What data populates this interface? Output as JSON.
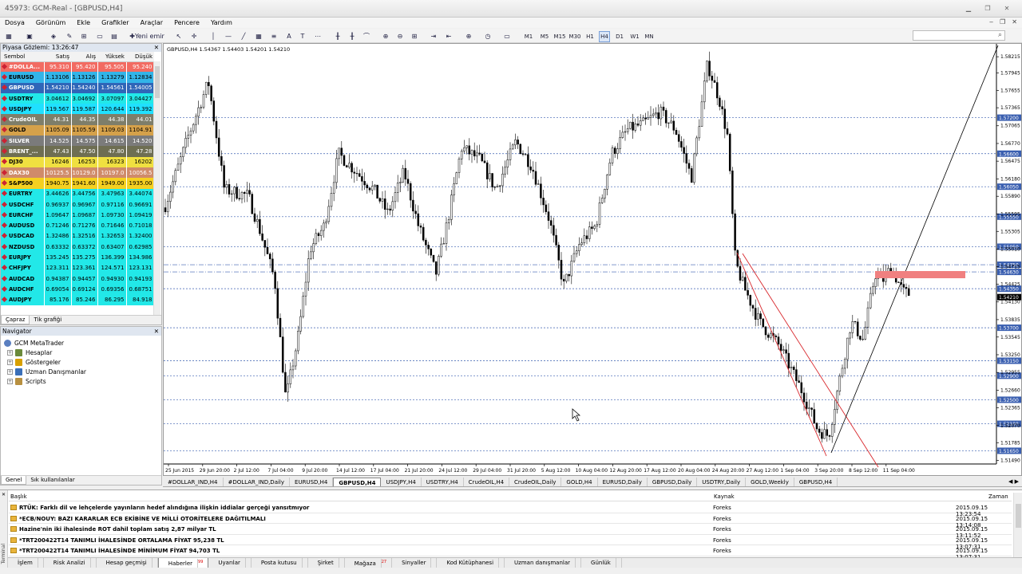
{
  "window": {
    "title": "45973: GCM-Real - [GBPUSD,H4]"
  },
  "menu": [
    "Dosya",
    "Görünüm",
    "Ekle",
    "Grafikler",
    "Araçlar",
    "Pencere",
    "Yardım"
  ],
  "toolbar": {
    "new_order": "Yeni emir",
    "timeframes": [
      "M1",
      "M5",
      "M15",
      "M30",
      "H1",
      "H4",
      "D1",
      "W1",
      "MN"
    ]
  },
  "market_watch": {
    "title": "Piyasa Gözlemi: 13:26:47",
    "columns": [
      "Sembol",
      "Satış",
      "Alış",
      "Yüksek",
      "Düşük"
    ],
    "rows": [
      {
        "sym": "#DOLLA...",
        "sell": "95.310",
        "buy": "95.420",
        "high": "95.505",
        "low": "95.240",
        "bg": "#f26b62",
        "fg": "#ffffff"
      },
      {
        "sym": "EURUSD",
        "sell": "1.13106",
        "buy": "1.13126",
        "high": "1.13279",
        "low": "1.12834",
        "bg": "#32b4e8",
        "fg": "#000000"
      },
      {
        "sym": "GBPUSD",
        "sell": "1.54210",
        "buy": "1.54240",
        "high": "1.54561",
        "low": "1.54005",
        "bg": "#2f66b8",
        "fg": "#ffffff"
      },
      {
        "sym": "USDTRY",
        "sell": "3.04612",
        "buy": "3.04692",
        "high": "3.07097",
        "low": "3.04427",
        "bg": "#22e8e8",
        "fg": "#000000"
      },
      {
        "sym": "USDJPY",
        "sell": "119.567",
        "buy": "119.587",
        "high": "120.644",
        "low": "119.392",
        "bg": "#20e0ff",
        "fg": "#000000"
      },
      {
        "sym": "CrudeOIL",
        "sell": "44.31",
        "buy": "44.35",
        "high": "44.38",
        "low": "44.01",
        "bg": "#7e7e6a",
        "fg": "#ffffff"
      },
      {
        "sym": "GOLD",
        "sell": "1105.09",
        "buy": "1105.59",
        "high": "1109.03",
        "low": "1104.91",
        "bg": "#d5a14a",
        "fg": "#000000"
      },
      {
        "sym": "SILVER",
        "sell": "14.525",
        "buy": "14.575",
        "high": "14.615",
        "low": "14.520",
        "bg": "#7b7b7b",
        "fg": "#ffffff"
      },
      {
        "sym": "BRENT_...",
        "sell": "47.43",
        "buy": "47.50",
        "high": "47.80",
        "low": "47.28",
        "bg": "#6e6e52",
        "fg": "#ffffff"
      },
      {
        "sym": "DJ30",
        "sell": "16246",
        "buy": "16253",
        "high": "16323",
        "low": "16202",
        "bg": "#f0e040",
        "fg": "#000000"
      },
      {
        "sym": "DAX30",
        "sell": "10125.5",
        "buy": "10129.0",
        "high": "10197.0",
        "low": "10056.5",
        "bg": "#d08b6a",
        "fg": "#ffffff"
      },
      {
        "sym": "S&P500",
        "sell": "1940.75",
        "buy": "1941.60",
        "high": "1949.00",
        "low": "1935.00",
        "bg": "#f5d020",
        "fg": "#000000"
      },
      {
        "sym": "EURTRY",
        "sell": "3.44626",
        "buy": "3.44756",
        "high": "3.47963",
        "low": "3.44074",
        "bg": "#22e8e8",
        "fg": "#000000"
      },
      {
        "sym": "USDCHF",
        "sell": "0.96937",
        "buy": "0.96967",
        "high": "0.97116",
        "low": "0.96691",
        "bg": "#22e8e8",
        "fg": "#000000"
      },
      {
        "sym": "EURCHF",
        "sell": "1.09647",
        "buy": "1.09687",
        "high": "1.09730",
        "low": "1.09419",
        "bg": "#22e8e8",
        "fg": "#000000"
      },
      {
        "sym": "AUDUSD",
        "sell": "0.71246",
        "buy": "0.71276",
        "high": "0.71646",
        "low": "0.71018",
        "bg": "#22e8e8",
        "fg": "#000000"
      },
      {
        "sym": "USDCAD",
        "sell": "1.32486",
        "buy": "1.32516",
        "high": "1.32653",
        "low": "1.32400",
        "bg": "#22e8e8",
        "fg": "#000000"
      },
      {
        "sym": "NZDUSD",
        "sell": "0.63332",
        "buy": "0.63372",
        "high": "0.63407",
        "low": "0.62985",
        "bg": "#22e8e8",
        "fg": "#000000"
      },
      {
        "sym": "EURJPY",
        "sell": "135.245",
        "buy": "135.275",
        "high": "136.399",
        "low": "134.986",
        "bg": "#22e8e8",
        "fg": "#000000"
      },
      {
        "sym": "CHFJPY",
        "sell": "123.311",
        "buy": "123.361",
        "high": "124.571",
        "low": "123.131",
        "bg": "#22e8e8",
        "fg": "#000000"
      },
      {
        "sym": "AUDCAD",
        "sell": "0.94387",
        "buy": "0.94457",
        "high": "0.94930",
        "low": "0.94193",
        "bg": "#22e8e8",
        "fg": "#000000"
      },
      {
        "sym": "AUDCHF",
        "sell": "0.69054",
        "buy": "0.69124",
        "high": "0.69356",
        "low": "0.68751",
        "bg": "#22e8e8",
        "fg": "#000000"
      },
      {
        "sym": "AUDJPY",
        "sell": "85.176",
        "buy": "85.246",
        "high": "86.295",
        "low": "84.918",
        "bg": "#22e8e8",
        "fg": "#000000"
      }
    ],
    "tabs": [
      "Çapraz",
      "Tik grafiği"
    ]
  },
  "navigator": {
    "title": "Navigator",
    "items": [
      "GCM MetaTrader",
      "Hesaplar",
      "Göstergeler",
      "Uzman Danışmanlar",
      "Scripts"
    ],
    "tabs": [
      "Genel",
      "Sık kullanılanlar"
    ]
  },
  "chart": {
    "info": "GBPUSD,H4  1.54367 1.54403 1.54201 1.54210",
    "price_labels": [
      "1.58215",
      "1.57945",
      "1.57655",
      "1.57365",
      "1.57065",
      "1.56770",
      "1.56475",
      "1.56180",
      "1.55890",
      "1.55595",
      "1.55305",
      "1.55010",
      "1.54715",
      "1.54425",
      "1.54130",
      "1.53835",
      "1.53545",
      "1.53250",
      "1.52955",
      "1.52660",
      "1.52365",
      "1.52070",
      "1.51785",
      "1.51490"
    ],
    "level_labels": [
      "1.57200",
      "1.56600",
      "1.56050",
      "1.55550",
      "1.55050",
      "1.54750",
      "1.54630",
      "1.54350",
      "1.53700",
      "1.53150",
      "1.52900",
      "1.52500",
      "1.52100",
      "1.51650"
    ],
    "current_price": "1.54210",
    "time_labels": [
      "25 Jun 2015",
      "29 Jun 20:00",
      "2 Jul 12:00",
      "7 Jul 04:00",
      "9 Jul 20:00",
      "14 Jul 12:00",
      "17 Jul 04:00",
      "21 Jul 20:00",
      "24 Jul 12:00",
      "29 Jul 04:00",
      "31 Jul 20:00",
      "5 Aug 12:00",
      "10 Aug 04:00",
      "12 Aug 20:00",
      "17 Aug 12:00",
      "20 Aug 04:00",
      "24 Aug 20:00",
      "27 Aug 12:00",
      "1 Sep 04:00",
      "3 Sep 20:00",
      "8 Sep 12:00",
      "11 Sep 04:00"
    ],
    "colors": {
      "up": "#000000",
      "down": "#000000",
      "level": "#3a5fb0",
      "channel": "#d8262b",
      "zone": "#f08080",
      "trend": "#000000"
    }
  },
  "chart_tabs": [
    "#DOLLAR_IND,H4",
    "#DOLLAR_IND,Daily",
    "EURUSD,H4",
    "GBPUSD,H4",
    "USDJPY,H4",
    "USDTRY,H4",
    "CrudeOIL,H4",
    "CrudeOIL,Daily",
    "GOLD,H4",
    "EURUSD,Daily",
    "GBPUSD,Daily",
    "USDTRY,Daily",
    "GOLD,Weekly",
    "GBPUSD,H4"
  ],
  "chart_tabs_active": 3,
  "news": {
    "columns": [
      "Başlık",
      "Kaynak",
      "Zaman"
    ],
    "rows": [
      {
        "title": "RTÜK: Farklı dil ve lehçelerde yayınların hedef alındığına ilişkin iddialar gerçeği yansıtmıyor",
        "source": "Foreks",
        "time": "2015.09.15 13:23:54"
      },
      {
        "title": "*ECB/NOUY: BAZI KARARLAR ECB EKİBİNE VE MİLLİ OTORİTELERE DAĞITILMALI",
        "source": "Foreks",
        "time": "2015.09.15 13:14:08"
      },
      {
        "title": "Hazine'nin iki ihalesinde ROT dahil toplam satış 2,87 milyar TL",
        "source": "Foreks",
        "time": "2015.09.15 13:11:52"
      },
      {
        "title": "*TRT200422T14 TANIMLI İHALESİNDE ORTALAMA FİYAT 95,238 TL",
        "source": "Foreks",
        "time": "2015.09.15 13:07:31"
      },
      {
        "title": "*TRT200422T14 TANIMLI İHALESİNDE MİNİMUM FİYAT 94,703 TL",
        "source": "Foreks",
        "time": "2015.09.15 13:07:31"
      }
    ]
  },
  "terminal": {
    "side_label": "Terminal",
    "tabs": [
      "İşlem",
      "Risk Analizi",
      "Hesap geçmişi",
      "Haberler",
      "Uyarılar",
      "Posta kutusu",
      "Şirket",
      "Mağaza",
      "Sinyaller",
      "Kod Kütüphanesi",
      "Uzman danışmanlar",
      "Günlük"
    ],
    "badges": {
      "Haberler": "99",
      "Mağaza": "27"
    },
    "active": "Haberler"
  }
}
